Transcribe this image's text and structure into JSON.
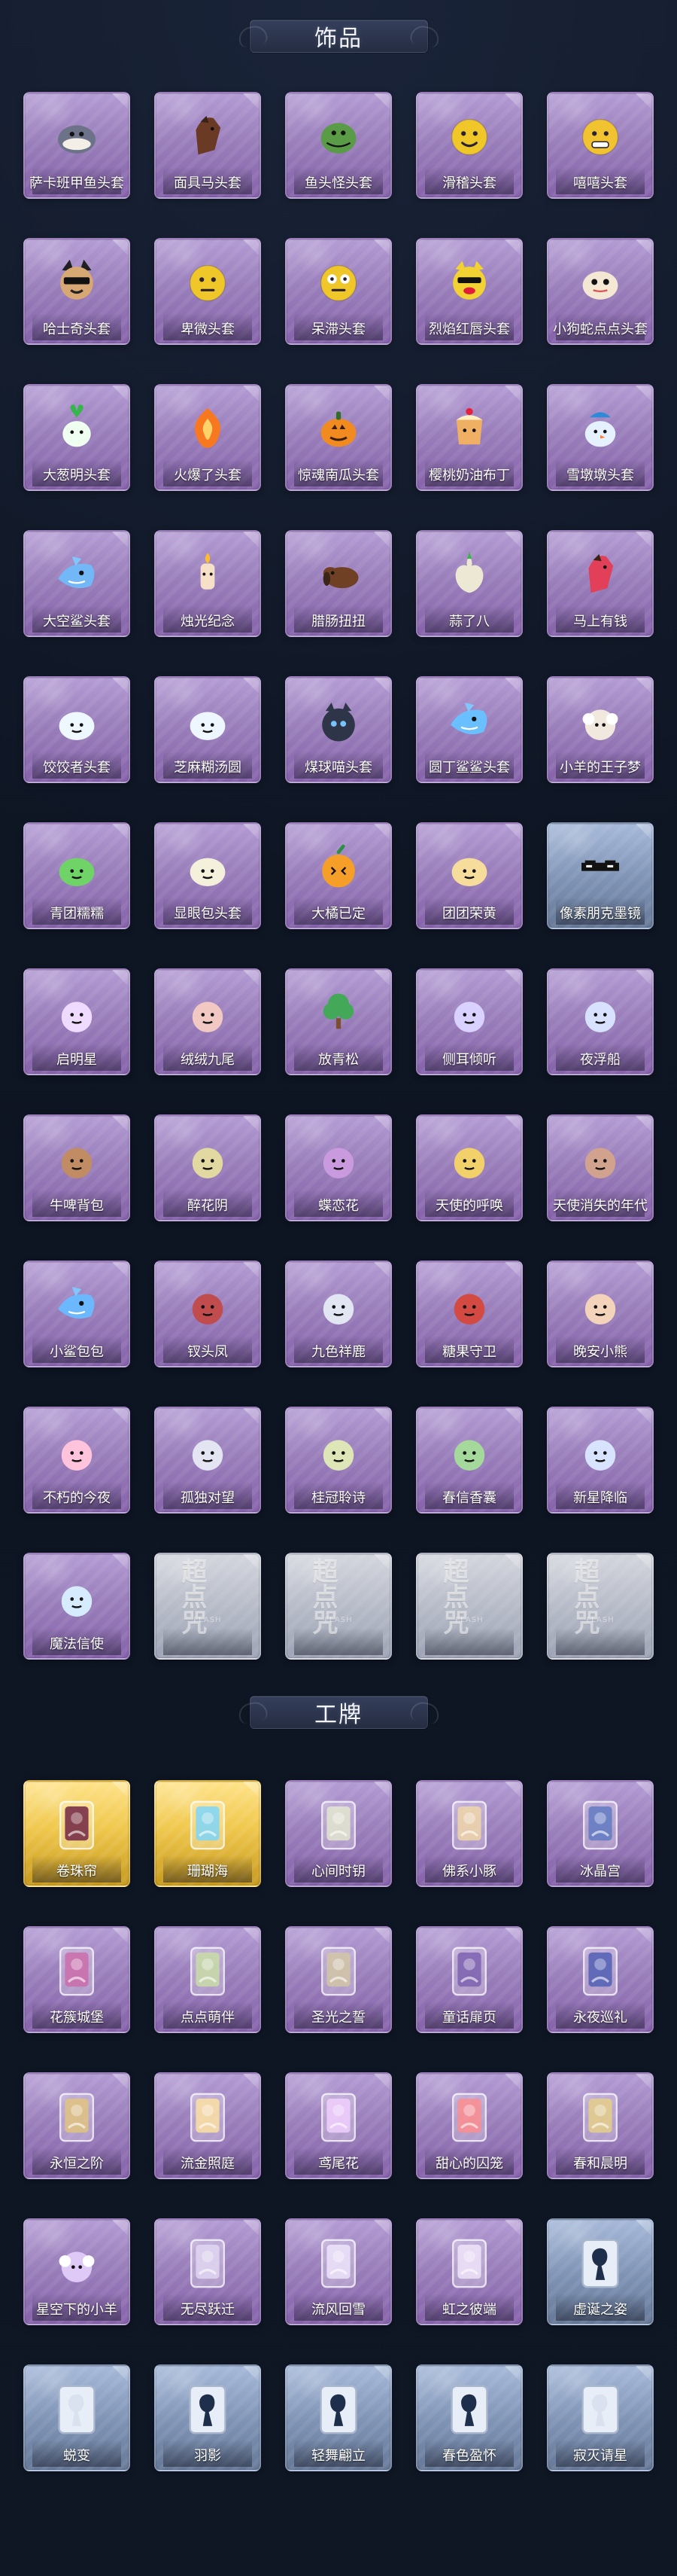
{
  "sections": {
    "accessories": {
      "title": "饰品",
      "items": [
        {
          "label": "萨卡班甲鱼头套",
          "icon": "fish-head-icon",
          "variant": "purple",
          "accent": "#6c7388"
        },
        {
          "label": "面具马头套",
          "icon": "horse-head-icon",
          "variant": "purple",
          "accent": "#6a3a25"
        },
        {
          "label": "鱼头怪头套",
          "icon": "fish-monster-head-icon",
          "variant": "purple",
          "accent": "#5a9b47"
        },
        {
          "label": "滑稽头套",
          "icon": "funny-face-icon",
          "variant": "purple",
          "accent": "#f0c729"
        },
        {
          "label": "嘻嘻头套",
          "icon": "grin-face-icon",
          "variant": "purple",
          "accent": "#f2c330"
        },
        {
          "label": "哈士奇头套",
          "icon": "husky-head-icon",
          "variant": "purple",
          "accent": "#1f1f22"
        },
        {
          "label": "卑微头套",
          "icon": "humble-face-icon",
          "variant": "purple",
          "accent": "#f0c729"
        },
        {
          "label": "呆滞头套",
          "icon": "blank-face-icon",
          "variant": "purple",
          "accent": "#f0c729"
        },
        {
          "label": "烈焰红唇头套",
          "icon": "red-lip-head-icon",
          "variant": "purple",
          "accent": "#f2d132"
        },
        {
          "label": "小狗蛇点点头套",
          "icon": "snake-dog-head-icon",
          "variant": "purple",
          "accent": "#f4e7d4"
        },
        {
          "label": "大葱明头套",
          "icon": "scallion-head-icon",
          "variant": "purple",
          "accent": "#77d96b"
        },
        {
          "label": "火爆了头套",
          "icon": "fire-head-icon",
          "variant": "purple",
          "accent": "#f7781f"
        },
        {
          "label": "惊魂南瓜头套",
          "icon": "pumpkin-head-icon",
          "variant": "purple",
          "accent": "#f28b1f"
        },
        {
          "label": "樱桃奶油布丁",
          "icon": "pudding-head-icon",
          "variant": "purple",
          "accent": "#f0b064"
        },
        {
          "label": "雪墩墩头套",
          "icon": "snowman-head-icon",
          "variant": "purple",
          "accent": "#e6f1ff"
        },
        {
          "label": "大空鲨头套",
          "icon": "shark-head-icon",
          "variant": "purple",
          "accent": "#73b8f6"
        },
        {
          "label": "烛光纪念",
          "icon": "candle-icon",
          "variant": "purple",
          "accent": "#f6e0c8"
        },
        {
          "label": "腊肠扭扭",
          "icon": "dachshund-icon",
          "variant": "purple",
          "accent": "#6f4024"
        },
        {
          "label": "蒜了八",
          "icon": "garlic-icon",
          "variant": "purple",
          "accent": "#ece8d4"
        },
        {
          "label": "马上有钱",
          "icon": "horse-money-icon",
          "variant": "purple",
          "accent": "#e23f59"
        },
        {
          "label": "饺饺者头套",
          "icon": "dumpling-head-icon",
          "variant": "purple",
          "accent": "#eef8ff"
        },
        {
          "label": "芝麻糊汤圆",
          "icon": "rice-ball-icon",
          "variant": "purple",
          "accent": "#eef7ff"
        },
        {
          "label": "煤球喵头套",
          "icon": "coal-cat-icon",
          "variant": "purple",
          "accent": "#2f3548"
        },
        {
          "label": "圆丁鲨鲨头套",
          "icon": "round-shark-icon",
          "variant": "purple",
          "accent": "#6ac0ff"
        },
        {
          "label": "小羊的王子梦",
          "icon": "sheep-prince-icon",
          "variant": "purple",
          "accent": "#f1e9de"
        },
        {
          "label": "青团糯糯",
          "icon": "green-dumpling-icon",
          "variant": "purple",
          "accent": "#70d367"
        },
        {
          "label": "显眼包头套",
          "icon": "flashy-bun-icon",
          "variant": "purple",
          "accent": "#f4f0dc"
        },
        {
          "label": "大橘已定",
          "icon": "orange-icon",
          "variant": "purple",
          "accent": "#f59e28"
        },
        {
          "label": "团团荣黄",
          "icon": "yellow-bun-icon",
          "variant": "purple",
          "accent": "#f7dd9c"
        },
        {
          "label": "像素朋克墨镜",
          "icon": "pixel-glasses-icon",
          "variant": "blue",
          "accent": "#121212"
        },
        {
          "label": "启明星",
          "icon": "star-dawn-icon",
          "variant": "purple",
          "accent": "#efdbff"
        },
        {
          "label": "绒绒九尾",
          "icon": "nine-tail-icon",
          "variant": "purple",
          "accent": "#f1c8c2"
        },
        {
          "label": "放青松",
          "icon": "pine-tree-icon",
          "variant": "purple",
          "accent": "#43a857"
        },
        {
          "label": "侧耳倾听",
          "icon": "listening-charm-icon",
          "variant": "purple",
          "accent": "#d9d1ff"
        },
        {
          "label": "夜浮船",
          "icon": "night-boat-icon",
          "variant": "purple",
          "accent": "#d8e2ff"
        },
        {
          "label": "牛啤背包",
          "icon": "bear-backpack-icon",
          "variant": "purple",
          "accent": "#c18c64"
        },
        {
          "label": "醉花阴",
          "icon": "flower-charm-icon",
          "variant": "purple",
          "accent": "#e2d8a1"
        },
        {
          "label": "蝶恋花",
          "icon": "butterfly-charm-icon",
          "variant": "purple",
          "accent": "#c99ade"
        },
        {
          "label": "天使的呼唤",
          "icon": "angel-charm-icon",
          "variant": "purple",
          "accent": "#f2d16a"
        },
        {
          "label": "天使消失的年代",
          "icon": "girl-charm-icon",
          "variant": "purple",
          "accent": "#d1a38e"
        },
        {
          "label": "小鲨包包",
          "icon": "shark-bag-icon",
          "variant": "purple",
          "accent": "#6cb8ff"
        },
        {
          "label": "钗头凤",
          "icon": "phoenix-crown-icon",
          "variant": "purple",
          "accent": "#c04c4e"
        },
        {
          "label": "九色祥鹿",
          "icon": "deer-charm-icon",
          "variant": "purple",
          "accent": "#e1e6f2"
        },
        {
          "label": "糖果守卫",
          "icon": "candy-guard-icon",
          "variant": "purple",
          "accent": "#d34a43"
        },
        {
          "label": "晚安小熊",
          "icon": "bear-charm-icon",
          "variant": "purple",
          "accent": "#f3d3b9"
        },
        {
          "label": "不朽的今夜",
          "icon": "night-charm-icon",
          "variant": "purple",
          "accent": "#ffc3dc"
        },
        {
          "label": "孤独对望",
          "icon": "doll-charm-icon",
          "variant": "purple",
          "accent": "#e3e5f3"
        },
        {
          "label": "桂冠聆诗",
          "icon": "laurel-charm-icon",
          "variant": "purple",
          "accent": "#dee6b8"
        },
        {
          "label": "春信香囊",
          "icon": "sachet-icon",
          "variant": "purple",
          "accent": "#a5d89b"
        },
        {
          "label": "新星降临",
          "icon": "star-charm-icon",
          "variant": "purple",
          "accent": "#d8e3ff"
        },
        {
          "label": "魔法信使",
          "icon": "mouse-mage-icon",
          "variant": "purple",
          "accent": "#d7ebff"
        },
        {
          "label": "",
          "icon": "placeholder-icon",
          "variant": "silver",
          "accent": "#ffffff",
          "watermark": "超点咒"
        },
        {
          "label": "",
          "icon": "placeholder-icon",
          "variant": "silver",
          "accent": "#ffffff",
          "watermark": "超点咒"
        },
        {
          "label": "",
          "icon": "placeholder-icon",
          "variant": "silver",
          "accent": "#ffffff",
          "watermark": "超点咒"
        },
        {
          "label": "",
          "icon": "placeholder-icon",
          "variant": "silver",
          "accent": "#ffffff",
          "watermark": "超点咒"
        }
      ]
    },
    "badges": {
      "title": "工牌",
      "items": [
        {
          "label": "卷珠帘",
          "icon": "badge-crimson-icon",
          "variant": "gold",
          "accent": "#6d1f43"
        },
        {
          "label": "珊瑚海",
          "icon": "badge-sea-icon",
          "variant": "gold",
          "accent": "#79d5ff"
        },
        {
          "label": "心间时钥",
          "icon": "badge-key-icon",
          "variant": "purple",
          "accent": "#e4e8cf"
        },
        {
          "label": "佛系小豚",
          "icon": "badge-dolphin-icon",
          "variant": "purple",
          "accent": "#f2d7a6"
        },
        {
          "label": "冰晶宫",
          "icon": "badge-ice-palace-icon",
          "variant": "purple",
          "accent": "#5d79c2"
        },
        {
          "label": "花簇城堡",
          "icon": "badge-castle-icon",
          "variant": "purple",
          "accent": "#cc6aa8"
        },
        {
          "label": "点点萌伴",
          "icon": "badge-dots-icon",
          "variant": "purple",
          "accent": "#c9dea5"
        },
        {
          "label": "圣光之誓",
          "icon": "badge-holy-light-icon",
          "variant": "purple",
          "accent": "#d3c7a4"
        },
        {
          "label": "童话扉页",
          "icon": "badge-fairy-page-icon",
          "variant": "purple",
          "accent": "#7b5fae"
        },
        {
          "label": "永夜巡礼",
          "icon": "badge-night-pilgrimage-icon",
          "variant": "purple",
          "accent": "#4d5db3"
        },
        {
          "label": "永恒之阶",
          "icon": "badge-eternal-step-icon",
          "variant": "purple",
          "accent": "#e2c57c"
        },
        {
          "label": "流金照庭",
          "icon": "badge-golden-court-icon",
          "variant": "purple",
          "accent": "#ffe3a0"
        },
        {
          "label": "鸢尾花",
          "icon": "badge-iris-icon",
          "variant": "purple",
          "accent": "#f3d1ff"
        },
        {
          "label": "甜心的囚笼",
          "icon": "badge-sweet-cage-icon",
          "variant": "purple",
          "accent": "#ff8c8c"
        },
        {
          "label": "春和晨明",
          "icon": "badge-spring-dawn-icon",
          "variant": "purple",
          "accent": "#e7cf85"
        },
        {
          "label": "星空下的小羊",
          "icon": "badge-starry-sheep-icon",
          "variant": "purple",
          "accent": "#dfc9f6"
        },
        {
          "label": "无尽跃迁",
          "icon": "badge-warp-icon",
          "variant": "purple",
          "accent": "#e2d8f3"
        },
        {
          "label": "流风回雪",
          "icon": "badge-wind-snow-icon",
          "variant": "purple",
          "accent": "#efe6fb"
        },
        {
          "label": "虹之彼端",
          "icon": "badge-rainbow-icon",
          "variant": "purple",
          "accent": "#f2e6fb"
        },
        {
          "label": "虚诞之姿",
          "icon": "badge-silhouette-a-icon",
          "variant": "blue",
          "accent": "#1d2f4a"
        },
        {
          "label": "蜕变",
          "icon": "badge-silhouette-b-icon",
          "variant": "blue",
          "accent": "#dbe2ef"
        },
        {
          "label": "羽影",
          "icon": "badge-silhouette-c-icon",
          "variant": "blue",
          "accent": "#1d2f4a"
        },
        {
          "label": "轻舞翩立",
          "icon": "badge-silhouette-d-icon",
          "variant": "blue",
          "accent": "#1d2f4a"
        },
        {
          "label": "春色盈怀",
          "icon": "badge-silhouette-e-icon",
          "variant": "blue",
          "accent": "#1d2f4a"
        },
        {
          "label": "寂灭请星",
          "icon": "badge-silhouette-f-icon",
          "variant": "blue",
          "accent": "#dbe2ef"
        }
      ]
    }
  },
  "watermark_sub": "FLASH"
}
